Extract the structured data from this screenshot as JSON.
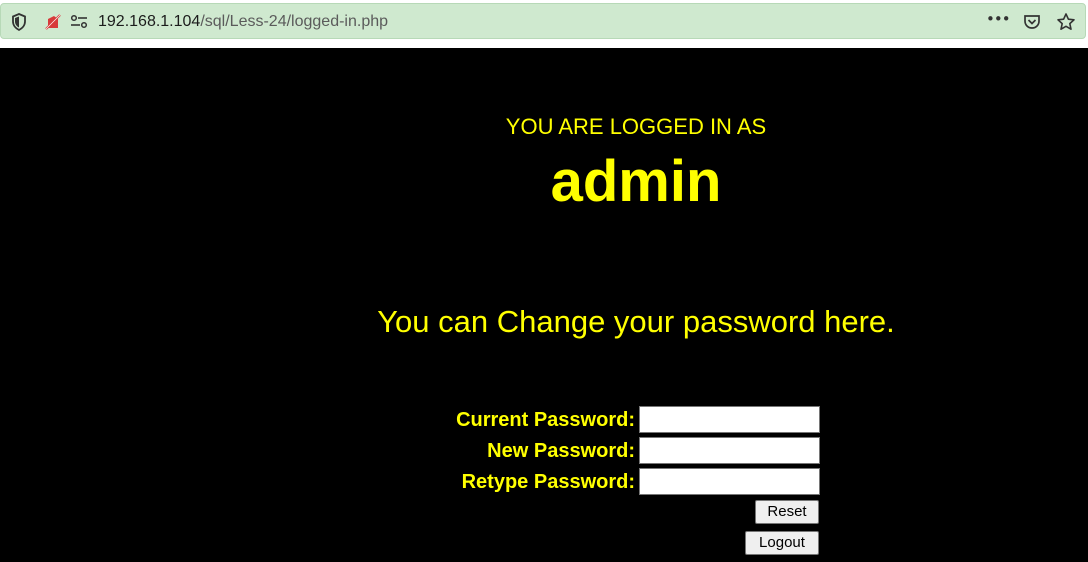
{
  "browser": {
    "url_host": "192.168.1.104",
    "url_path": "/sql/Less-24/logged-in.php",
    "icons": [
      "shield-icon",
      "tracking-off-icon",
      "permissions-icon",
      "more-icon",
      "pocket-icon",
      "bookmark-star-icon"
    ],
    "more_label": "•••",
    "bar_color": "#cfe9cf"
  },
  "page": {
    "logged_label": "YOU ARE LOGGED IN AS",
    "username": "admin",
    "change_message": "You can Change your password here.",
    "text_color": "#ffff00",
    "background": "#000000"
  },
  "form": {
    "current_password_label": "Current Password:",
    "new_password_label": "New Password:",
    "retype_password_label": "Retype Password:",
    "current_password_value": "",
    "new_password_value": "",
    "retype_password_value": "",
    "reset_label": "Reset",
    "logout_label": "Logout"
  }
}
